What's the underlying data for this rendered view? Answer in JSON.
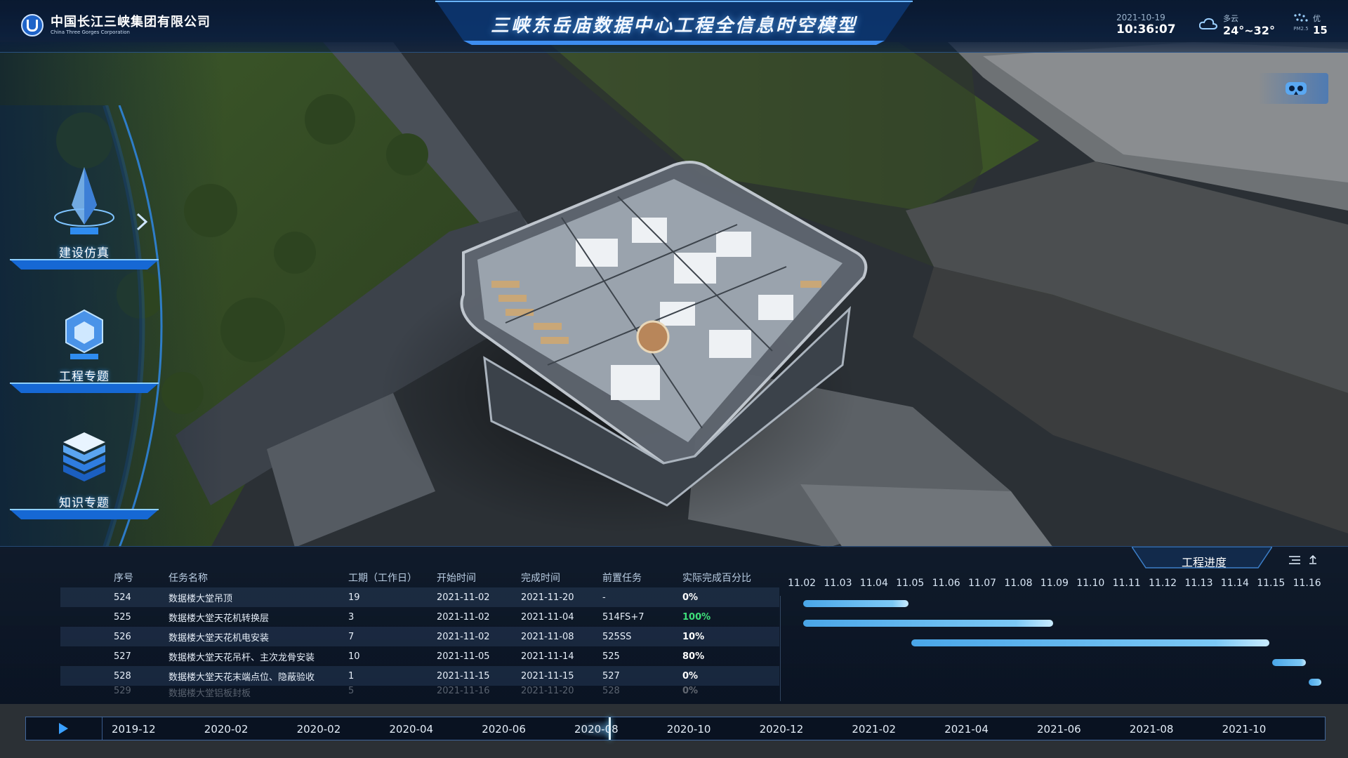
{
  "header": {
    "company_cn": "中国长江三峡集团有限公司",
    "company_en": "China Three Gorges Corporation",
    "title": "三峡东岳庙数据中心工程全信息时空模型",
    "date": "2021-10-19",
    "time": "10:36:07",
    "weather": {
      "desc": "多云",
      "temp": "24°~32°",
      "icon": "cloud-icon"
    },
    "aqi": {
      "label": "PM2.5",
      "level": "优",
      "value": "15",
      "icon": "pm25-icon"
    }
  },
  "side_menu": {
    "items": [
      {
        "label": "建设仿真",
        "icon": "crystal-pyramid-icon"
      },
      {
        "label": "工程专题",
        "icon": "hexagon-cube-icon"
      },
      {
        "label": "知识专题",
        "icon": "stacked-layers-icon"
      }
    ],
    "expand_icon": "chevron-right-icon"
  },
  "vr_icon": "vr-headset-icon",
  "progress_panel": {
    "title": "工程进度",
    "columns": [
      "序号",
      "任务名称",
      "工期（工作日）",
      "开始时间",
      "完成时间",
      "前置任务",
      "实际完成百分比"
    ],
    "rows": [
      {
        "id": "524",
        "name": "数据楼大堂吊顶",
        "duration": "19",
        "start": "2021-11-02",
        "end": "2021-11-20",
        "pred": "-",
        "pct": "0%"
      },
      {
        "id": "525",
        "name": "数据楼大堂天花机转换层",
        "duration": "3",
        "start": "2021-11-02",
        "end": "2021-11-04",
        "pred": "514FS+7",
        "pct": "100%"
      },
      {
        "id": "526",
        "name": "数据楼大堂天花机电安装",
        "duration": "7",
        "start": "2021-11-02",
        "end": "2021-11-08",
        "pred": "525SS",
        "pct": "10%"
      },
      {
        "id": "527",
        "name": "数据楼大堂天花吊杆、主次龙骨安装",
        "duration": "10",
        "start": "2021-11-05",
        "end": "2021-11-14",
        "pred": "525",
        "pct": "80%"
      },
      {
        "id": "528",
        "name": "数据楼大堂天花末端点位、隐蔽验收",
        "duration": "1",
        "start": "2021-11-15",
        "end": "2021-11-15",
        "pred": "527",
        "pct": "0%"
      },
      {
        "id": "529",
        "name": "数据楼大堂铝板封板",
        "duration": "5",
        "start": "2021-11-16",
        "end": "2021-11-20",
        "pred": "528",
        "pct": "0%"
      }
    ],
    "gantt_dates": [
      "11.02",
      "11.03",
      "11.04",
      "11.05",
      "11.06",
      "11.07",
      "11.08",
      "11.09",
      "11.10",
      "11.11",
      "11.12",
      "11.13",
      "11.14",
      "11.15",
      "11.16"
    ],
    "pct_colors": {
      "done": "#3ee07a",
      "default": "#ffffff"
    }
  },
  "timeline": {
    "ticks": [
      "2019-12",
      "2020-02",
      "2020-02",
      "2020-04",
      "2020-06",
      "2020-08",
      "2020-10",
      "2020-12",
      "2021-02",
      "2021-04",
      "2021-06",
      "2021-08",
      "2021-10"
    ]
  },
  "colors": {
    "accent": "#3aa0ff",
    "panel": "#0a1628",
    "bar": "#5bb5ee"
  }
}
